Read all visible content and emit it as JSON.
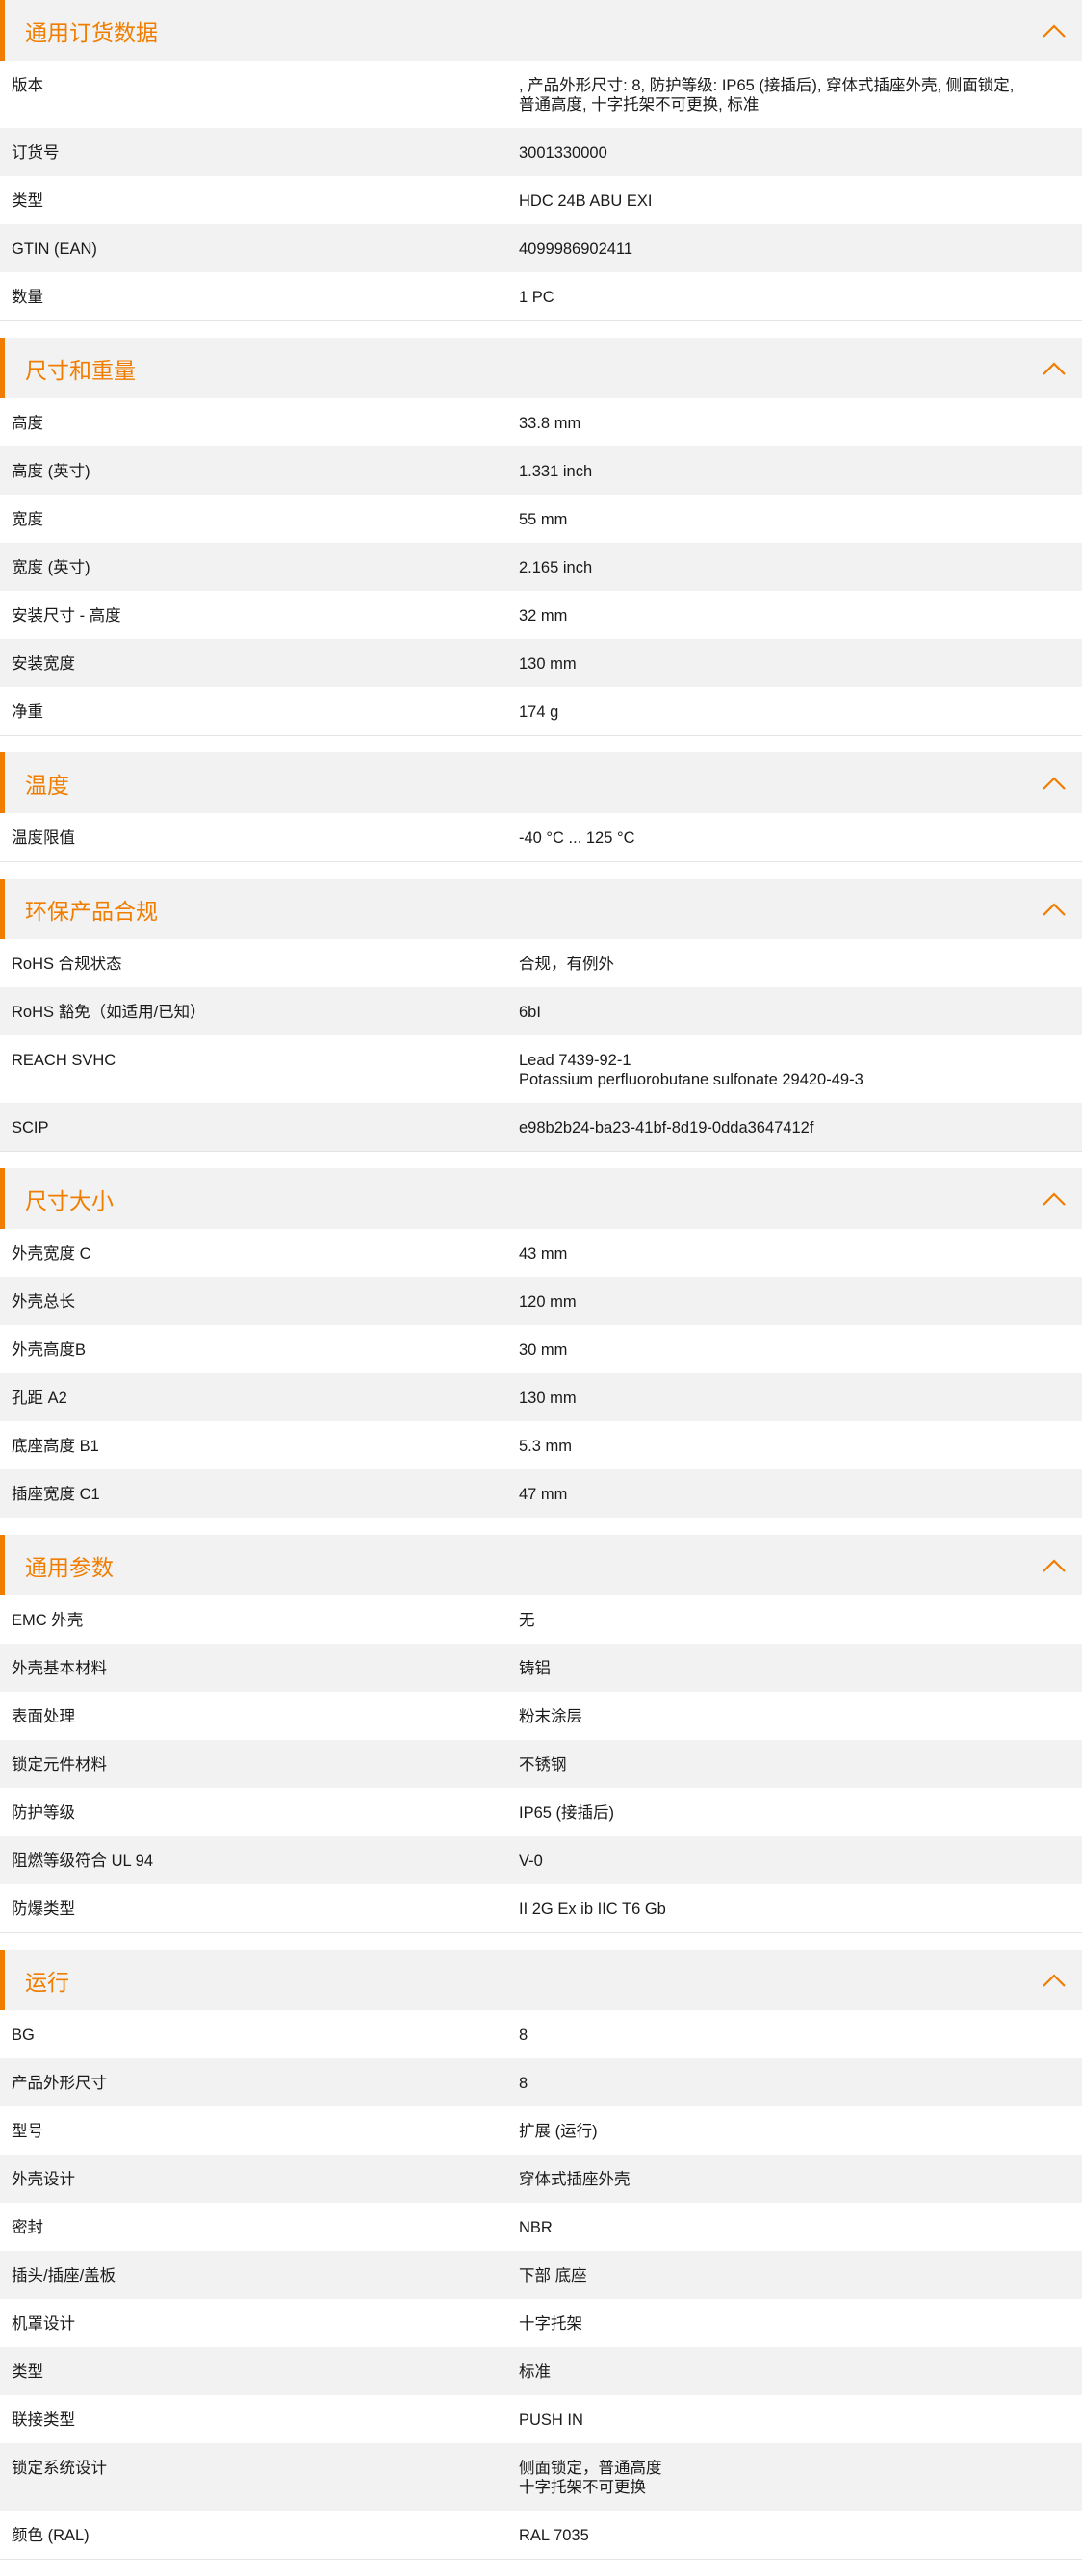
{
  "accent_color": "#f07d00",
  "header_background": "#f2f2f2",
  "collapse_icon": "chevron-up-icon",
  "sections": [
    {
      "title": "通用订货数据",
      "rows": [
        {
          "label": "版本",
          "value": [
            ", 产品外形尺寸: 8, 防护等级: IP65 (接插后), 穿体式插座外壳, 侧面锁定,",
            "普通高度, 十字托架不可更换, 标准"
          ]
        },
        {
          "label": "订货号",
          "value": [
            "3001330000"
          ]
        },
        {
          "label": "类型",
          "value": [
            "HDC 24B ABU EXI"
          ]
        },
        {
          "label": "GTIN (EAN)",
          "value": [
            "4099986902411"
          ]
        },
        {
          "label": "数量",
          "value": [
            "1  PC"
          ]
        }
      ]
    },
    {
      "title": "尺寸和重量",
      "rows": [
        {
          "label": "高度",
          "value": [
            "33.8  mm"
          ]
        },
        {
          "label": "高度 (英寸)",
          "value": [
            "1.331  inch"
          ]
        },
        {
          "label": "宽度",
          "value": [
            "55  mm"
          ]
        },
        {
          "label": "宽度 (英寸)",
          "value": [
            "2.165  inch"
          ]
        },
        {
          "label": "安装尺寸 - 高度",
          "value": [
            "32  mm"
          ]
        },
        {
          "label": "安装宽度",
          "value": [
            "130  mm"
          ]
        },
        {
          "label": "净重",
          "value": [
            "174  g"
          ]
        }
      ]
    },
    {
      "title": "温度",
      "rows": [
        {
          "label": "温度限值",
          "value": [
            "-40 °C ... 125 °C"
          ]
        }
      ]
    },
    {
      "title": "环保产品合规",
      "rows": [
        {
          "label": "RoHS 合规状态",
          "value": [
            "合规，有例外"
          ]
        },
        {
          "label": "RoHS 豁免（如适用/已知）",
          "value": [
            "6bI"
          ]
        },
        {
          "label": "REACH SVHC",
          "value": [
            "Lead 7439-92-1",
            "Potassium perfluorobutane sulfonate 29420-49-3"
          ]
        },
        {
          "label": "SCIP",
          "value": [
            "e98b2b24-ba23-41bf-8d19-0dda3647412f"
          ]
        }
      ]
    },
    {
      "title": "尺寸大小",
      "rows": [
        {
          "label": "外壳宽度 C",
          "value": [
            "43  mm"
          ]
        },
        {
          "label": "外壳总长",
          "value": [
            "120  mm"
          ]
        },
        {
          "label": "外壳高度B",
          "value": [
            "30  mm"
          ]
        },
        {
          "label": "孔距 A2",
          "value": [
            "130  mm"
          ]
        },
        {
          "label": "底座高度 B1",
          "value": [
            "5.3  mm"
          ]
        },
        {
          "label": "插座宽度 C1",
          "value": [
            "47  mm"
          ]
        }
      ]
    },
    {
      "title": "通用参数",
      "rows": [
        {
          "label": "EMC 外壳",
          "value": [
            "无"
          ]
        },
        {
          "label": "外壳基本材料",
          "value": [
            "铸铝"
          ]
        },
        {
          "label": "表面处理",
          "value": [
            "粉末涂层"
          ]
        },
        {
          "label": "锁定元件材料",
          "value": [
            "不锈钢"
          ]
        },
        {
          "label": "防护等级",
          "value": [
            "IP65 (接插后)"
          ]
        },
        {
          "label": "阻燃等级符合 UL 94",
          "value": [
            "V-0"
          ]
        },
        {
          "label": "防爆类型",
          "value": [
            "II 2G Ex ib IIC T6 Gb"
          ]
        }
      ]
    },
    {
      "title": "运行",
      "rows": [
        {
          "label": "BG",
          "value": [
            "8"
          ]
        },
        {
          "label": "产品外形尺寸",
          "value": [
            "8"
          ]
        },
        {
          "label": "型号",
          "value": [
            "扩展 (运行)"
          ]
        },
        {
          "label": "外壳设计",
          "value": [
            "穿体式插座外壳"
          ]
        },
        {
          "label": "密封",
          "value": [
            "NBR"
          ]
        },
        {
          "label": "插头/插座/盖板",
          "value": [
            "下部 底座"
          ]
        },
        {
          "label": "机罩设计",
          "value": [
            "十字托架"
          ]
        },
        {
          "label": "类型",
          "value": [
            "标准"
          ]
        },
        {
          "label": "联接类型",
          "value": [
            "PUSH IN"
          ]
        },
        {
          "label": "锁定系统设计",
          "value": [
            "侧面锁定，普通高度",
            "十字托架不可更换"
          ]
        },
        {
          "label": "颜色 (RAL)",
          "value": [
            "RAL 7035"
          ]
        }
      ]
    }
  ]
}
